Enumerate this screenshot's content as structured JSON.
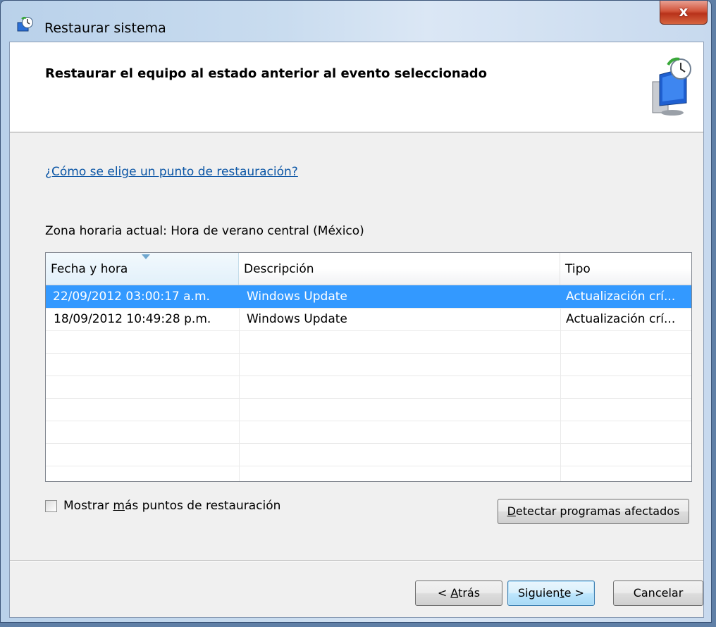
{
  "window": {
    "title": "Restaurar sistema",
    "close_label": "x"
  },
  "header": {
    "title": "Restaurar el equipo al estado anterior al evento seleccionado"
  },
  "help_link": "¿Cómo se elige un punto de restauración?",
  "timezone": "Zona horaria actual: Hora de verano central (México)",
  "restore_points": {
    "columns": [
      {
        "label": "Fecha y hora",
        "sorted": true
      },
      {
        "label": "Descripción",
        "sorted": false
      },
      {
        "label": "Tipo",
        "sorted": false
      }
    ],
    "rows": [
      {
        "date": "22/09/2012 03:00:17 a.m.",
        "description": "Windows Update",
        "type": "Actualización crí...",
        "selected": true
      },
      {
        "date": "18/09/2012 10:49:28 p.m.",
        "description": "Windows Update",
        "type": "Actualización crí...",
        "selected": false
      }
    ]
  },
  "show_more": {
    "label_pre": "Mostrar ",
    "label_accel": "m",
    "label_post": "ás puntos de restauración",
    "checked": false
  },
  "buttons": {
    "detect_accel": "D",
    "detect_rest": "etectar programas afectados",
    "back_pre": "< ",
    "back_accel": "A",
    "back_rest": "trás",
    "next_pre": "Siguien",
    "next_accel": "t",
    "next_rest": "e >",
    "cancel": "Cancelar"
  },
  "colors": {
    "selection": "#3399ff",
    "link": "#0a55a5",
    "close_button": "#c7432a"
  }
}
